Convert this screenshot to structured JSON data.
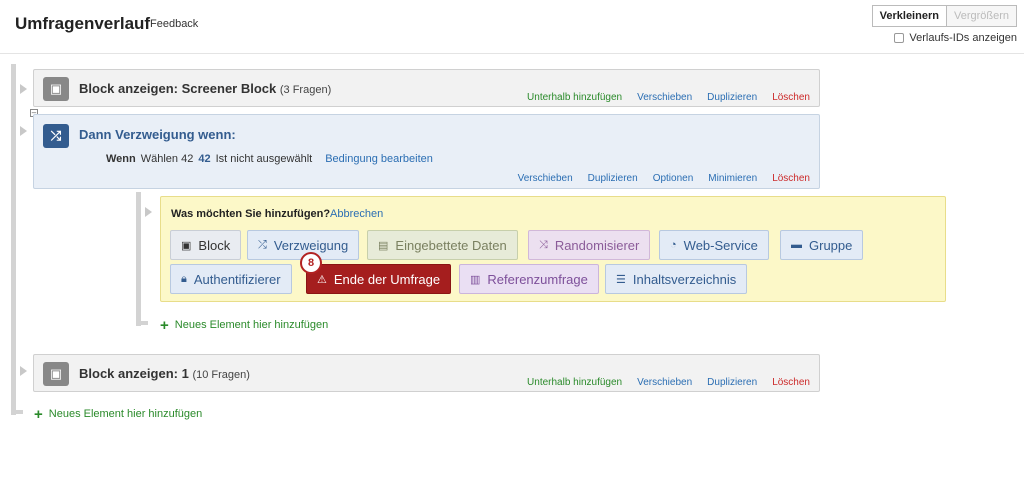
{
  "header": {
    "title": "Umfragenverlauf",
    "feedback": "Feedback",
    "zoom_out": "Verkleinern",
    "zoom_in": "Vergrößern",
    "show_ids": "Verlaufs-IDs anzeigen"
  },
  "block1": {
    "title": "Block anzeigen: Screener Block",
    "count": "(3 Fragen)",
    "actions": {
      "add_below": "Unterhalb hinzufügen",
      "move": "Verschieben",
      "duplicate": "Duplizieren",
      "delete": "Löschen"
    }
  },
  "branch": {
    "title": "Dann Verzweigung wenn:",
    "condition": {
      "wenn": "Wenn",
      "choose": "Wählen 42",
      "value": "42",
      "state": "Ist nicht ausgewählt",
      "edit": "Bedingung bearbeiten"
    },
    "actions": {
      "move": "Verschieben",
      "duplicate": "Duplizieren",
      "options": "Optionen",
      "minimize": "Minimieren",
      "delete": "Löschen"
    }
  },
  "add_panel": {
    "question": "Was möchten Sie hinzufügen?",
    "cancel": "Abbrechen",
    "options": {
      "block": "Block",
      "branch": "Verzweigung",
      "embedded": "Eingebettete Daten",
      "randomizer": "Randomisierer",
      "webservice": "Web-Service",
      "group": "Gruppe",
      "auth": "Authentifizierer",
      "end": "Ende der Umfrage",
      "reference": "Referenzumfrage",
      "toc": "Inhaltsverzeichnis"
    },
    "badge": "8"
  },
  "new_element_inner": "Neues Element hier hinzufügen",
  "block2": {
    "title": "Block anzeigen: 1",
    "count": "(10 Fragen)",
    "actions": {
      "add_below": "Unterhalb hinzufügen",
      "move": "Verschieben",
      "duplicate": "Duplizieren",
      "delete": "Löschen"
    }
  },
  "new_element_outer": "Neues Element hier hinzufügen"
}
